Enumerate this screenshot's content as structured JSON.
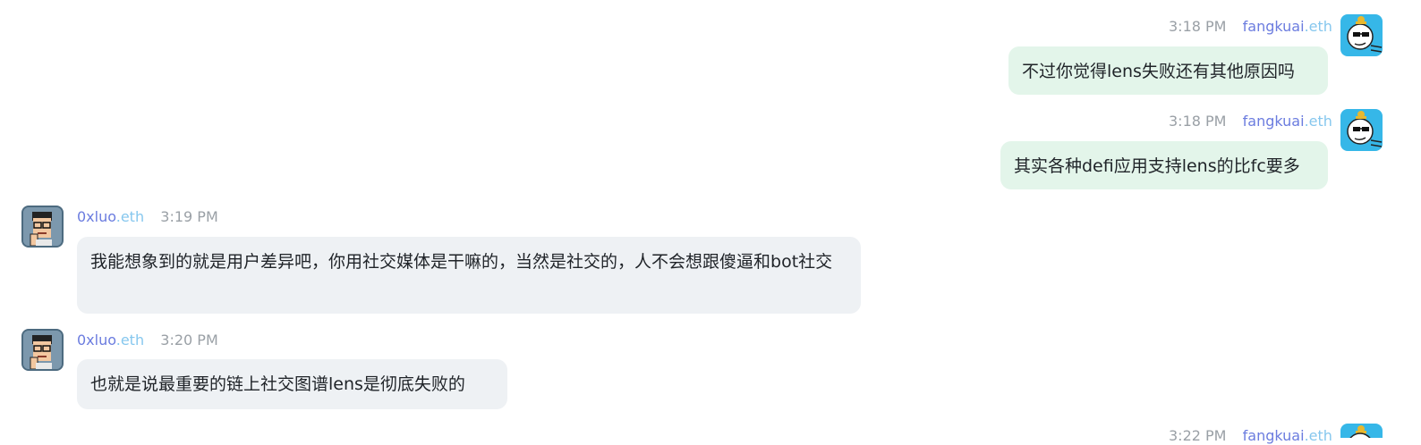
{
  "messages": [
    {
      "side": "right",
      "time": "3:18 PM",
      "name_main": "fangkuai",
      "name_suffix": ".eth",
      "text": "不过你觉得lens失败还有其他原因吗",
      "avatar": "cartoon-avatar-icon"
    },
    {
      "side": "right",
      "time": "3:18 PM",
      "name_main": "fangkuai",
      "name_suffix": ".eth",
      "text": "其实各种defi应用支持lens的比fc要多",
      "avatar": "cartoon-avatar-icon"
    },
    {
      "side": "left",
      "time": "3:19 PM",
      "name_main": "0xluo",
      "name_suffix": ".eth",
      "text": "我能想象到的就是用户差异吧，你用社交媒体是干嘛的，当然是社交的，人不会想跟傻逼和bot社交",
      "avatar": "pixel-avatar-icon"
    },
    {
      "side": "left",
      "time": "3:20 PM",
      "name_main": "0xluo",
      "name_suffix": ".eth",
      "text": "也就是说最重要的链上社交图谱lens是彻底失败的",
      "avatar": "pixel-avatar-icon"
    },
    {
      "side": "right",
      "time": "3:22 PM",
      "name_main": "fangkuai",
      "name_suffix": ".eth",
      "text": "",
      "avatar": "cartoon-avatar-icon"
    }
  ],
  "colors": {
    "outgoing_bubble": "#e3f5ea",
    "incoming_bubble": "#eef1f4",
    "name": "#6b7cdf",
    "suffix": "#86c7ee",
    "time": "#9aa0a6"
  }
}
